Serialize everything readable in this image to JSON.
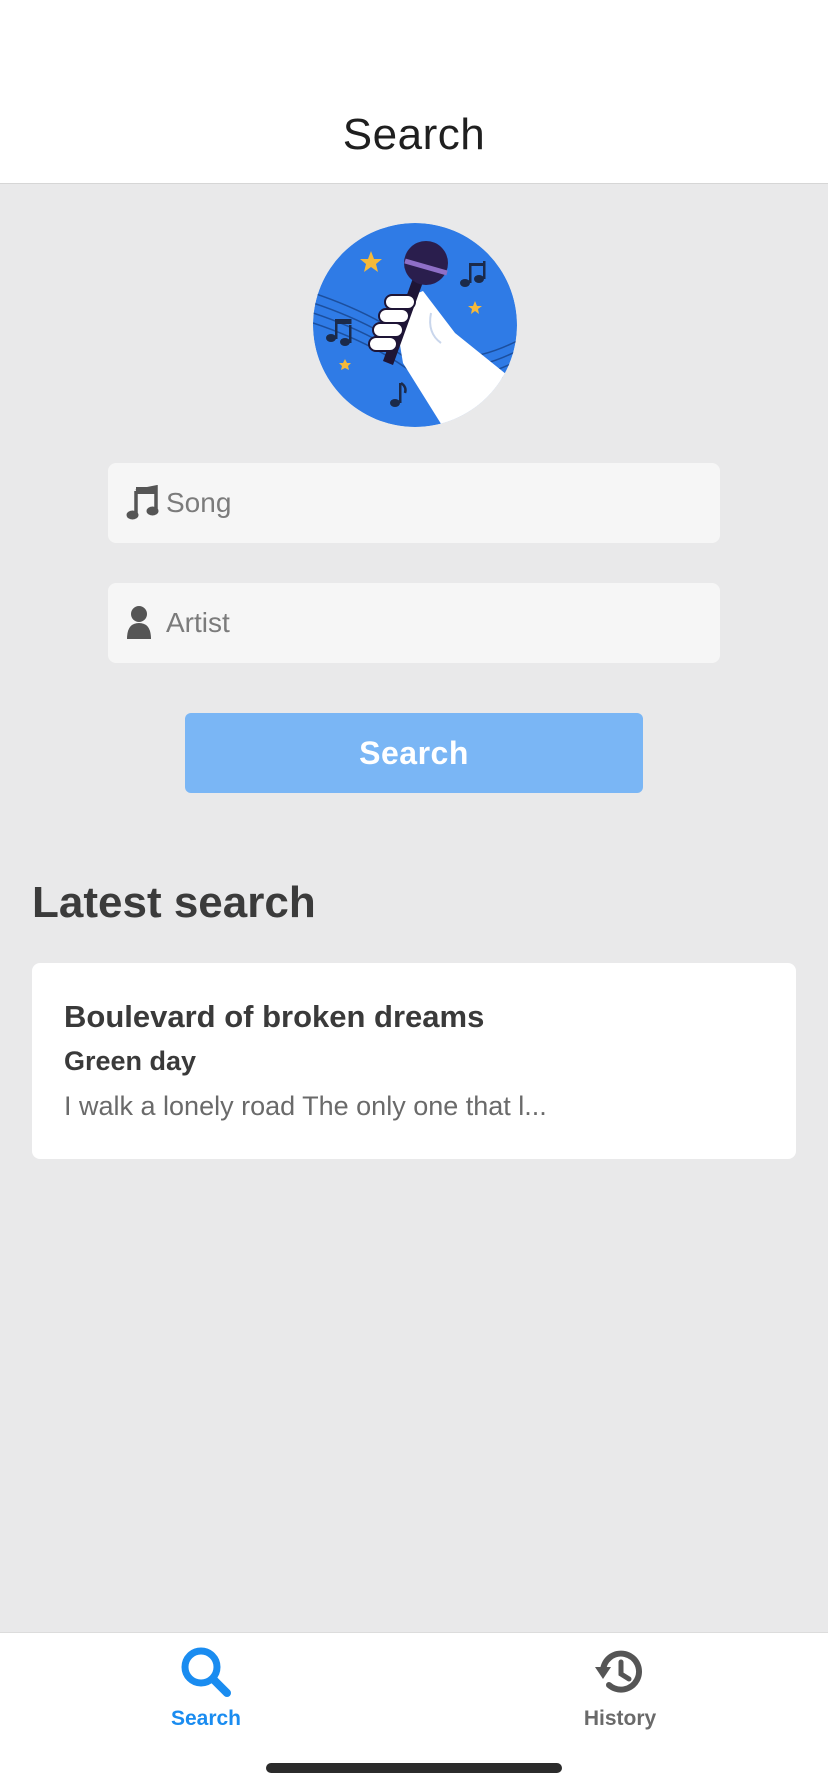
{
  "header": {
    "title": "Search"
  },
  "logo": {
    "icon": "microphone-fist-icon",
    "bg_color": "#2f7be6"
  },
  "form": {
    "song": {
      "placeholder": "Song",
      "value": "",
      "icon": "music-note-icon"
    },
    "artist": {
      "placeholder": "Artist",
      "value": "",
      "icon": "person-icon"
    },
    "search_label": "Search",
    "button_color": "#7ab6f5"
  },
  "latest": {
    "title": "Latest search",
    "item": {
      "song": "Boulevard of broken dreams",
      "artist": "Green day",
      "snippet": "I walk a lonely road The only one that l..."
    }
  },
  "tabs": [
    {
      "label": "Search",
      "icon": "search-icon",
      "active": true,
      "color": "#1a8cf0"
    },
    {
      "label": "History",
      "icon": "history-icon",
      "active": false,
      "color": "#6a6a6a"
    }
  ]
}
